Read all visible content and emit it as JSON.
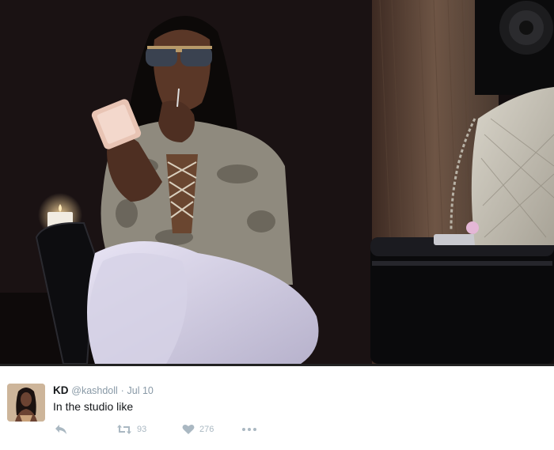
{
  "tweet": {
    "display_name": "KD",
    "handle": "@kashdoll",
    "separator": "·",
    "date": "Jul 10",
    "text": "In the studio like",
    "retweet_count": "93",
    "like_count": "276"
  },
  "icons": {
    "reply": "reply-icon",
    "retweet": "retweet-icon",
    "like": "heart-icon",
    "more": "more-dots-icon"
  },
  "colors": {
    "action_icon": "#aab8c2",
    "secondary_text": "#8899a6",
    "primary_text": "#14171a"
  }
}
